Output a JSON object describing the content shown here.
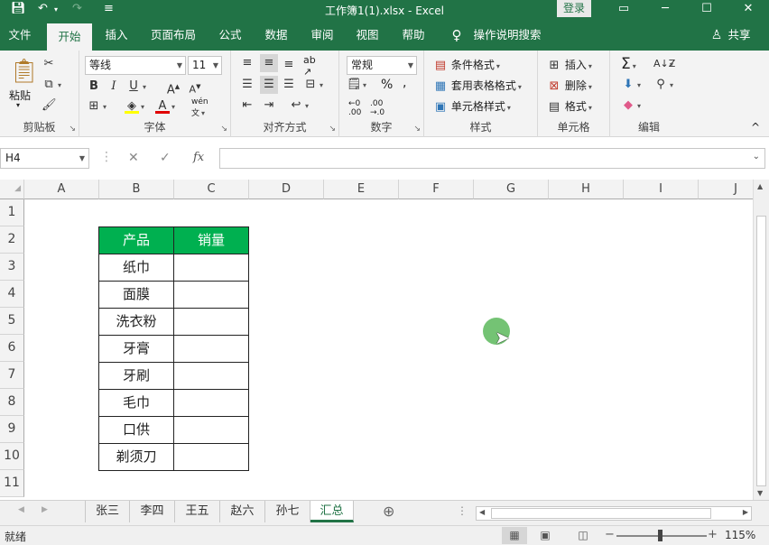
{
  "window": {
    "title": "工作簿1(1).xlsx  -  Excel",
    "login_label": "登录"
  },
  "menu": {
    "tabs": [
      "文件",
      "开始",
      "插入",
      "页面布局",
      "公式",
      "数据",
      "审阅",
      "视图",
      "帮助"
    ],
    "search_label": "操作说明搜索",
    "share_label": "共享"
  },
  "ribbon": {
    "clipboard": {
      "paste": "粘贴",
      "label": "剪贴板"
    },
    "font": {
      "name": "等线",
      "size": "11",
      "label": "字体"
    },
    "alignment": {
      "label": "对齐方式"
    },
    "number": {
      "format": "常规",
      "label": "数字"
    },
    "styles": {
      "conditional": "条件格式",
      "table": "套用表格格式",
      "cell_styles": "单元格样式",
      "label": "样式"
    },
    "cells": {
      "insert": "插入",
      "delete": "删除",
      "format": "格式",
      "label": "单元格"
    },
    "editing": {
      "label": "编辑"
    }
  },
  "formula_bar": {
    "name_box": "H4",
    "content": ""
  },
  "grid": {
    "columns": [
      "A",
      "B",
      "C",
      "D",
      "E",
      "F",
      "G",
      "H",
      "I",
      "J"
    ],
    "rows": [
      "1",
      "2",
      "3",
      "4",
      "5",
      "6",
      "7",
      "8",
      "9",
      "10",
      "11"
    ],
    "table": {
      "header": [
        "产品",
        "销量"
      ],
      "products": [
        "纸巾",
        "面膜",
        "洗衣粉",
        "牙膏",
        "牙刷",
        "毛巾",
        "口供",
        "剃须刀"
      ]
    }
  },
  "sheets": {
    "tabs": [
      "张三",
      "李四",
      "王五",
      "赵六",
      "孙七",
      "汇总"
    ],
    "active": "汇总"
  },
  "status": {
    "ready": "就绪",
    "zoom": "115%"
  },
  "colors": {
    "accent": "#217346",
    "table_header": "#00b050"
  }
}
